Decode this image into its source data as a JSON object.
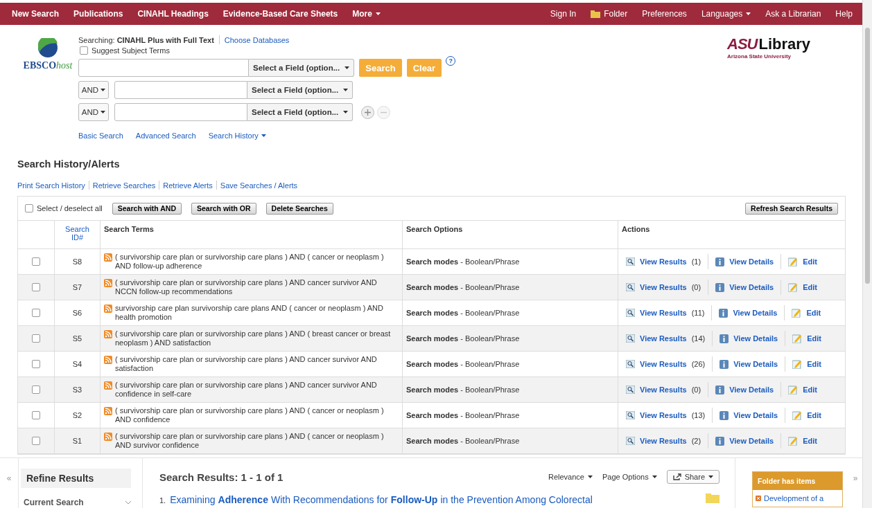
{
  "nav": {
    "left": [
      {
        "label": "New Search",
        "kind": "link"
      },
      {
        "label": "Publications",
        "kind": "link"
      },
      {
        "label": "CINAHL Headings",
        "kind": "link"
      },
      {
        "label": "Evidence-Based Care Sheets",
        "kind": "link"
      },
      {
        "label": "More",
        "kind": "menu"
      }
    ],
    "right": [
      {
        "label": "Sign In",
        "kind": "link"
      },
      {
        "label": "Folder",
        "kind": "folder"
      },
      {
        "label": "Preferences",
        "kind": "link"
      },
      {
        "label": "Languages",
        "kind": "menu"
      },
      {
        "label": "Ask a Librarian",
        "kind": "link"
      },
      {
        "label": "Help",
        "kind": "link"
      }
    ]
  },
  "logo": {
    "text": "EBSCO",
    "suffix": "host"
  },
  "library_logo": {
    "mark": "ASU",
    "name": "Library",
    "subtitle": "Arizona State University"
  },
  "search": {
    "searching_label": "Searching:",
    "database": "CINAHL Plus with Full Text",
    "choose_link": "Choose Databases",
    "suggest": {
      "label": "Suggest Subject Terms",
      "checked": false
    },
    "rows": [
      {
        "field": "Select a Field (option..."
      },
      {
        "operator": "AND",
        "field": "Select a Field (option..."
      },
      {
        "operator": "AND",
        "field": "Select a Field (option..."
      }
    ],
    "search_button": "Search",
    "clear_button": "Clear",
    "help": "?",
    "links": [
      {
        "label": "Basic Search",
        "kind": "link"
      },
      {
        "label": "Advanced Search",
        "kind": "link"
      },
      {
        "label": "Search History",
        "kind": "menu"
      }
    ]
  },
  "history": {
    "title": "Search History/Alerts",
    "links": [
      "Print Search History",
      "Retrieve Searches",
      "Retrieve Alerts",
      "Save Searches / Alerts"
    ],
    "select_all": {
      "label": "Select / deselect all",
      "checked": false
    },
    "buttons": [
      "Search with AND",
      "Search with OR",
      "Delete Searches"
    ],
    "refresh_button": "Refresh Search Results",
    "columns": [
      "Search ID#",
      "Search Terms",
      "Search Options",
      "Actions"
    ],
    "rows": [
      {
        "id": "S8",
        "selected": false,
        "terms": "( survivorship care plan or survivorship care plans ) AND ( cancer or neoplasm ) AND follow-up adherence",
        "options": "**Search modes** - Boolean/Phrase",
        "view_results": "View Results",
        "count": "(1)",
        "view_details": "View Details",
        "edit": "Edit"
      },
      {
        "id": "S7",
        "selected": false,
        "terms": "( survivorship care plan or survivorship care plans ) AND cancer survivor AND NCCN follow-up recommendations",
        "options": "**Search modes** - Boolean/Phrase",
        "view_results": "View Results",
        "count": "(0)",
        "view_details": "View Details",
        "edit": "Edit"
      },
      {
        "id": "S6",
        "selected": false,
        "terms": "survivorship care plan survivorship care plans AND ( cancer or neoplasm ) AND health promotion",
        "options": "**Search modes** - Boolean/Phrase",
        "view_results": "View Results",
        "count": "(11)",
        "view_details": "View Details",
        "edit": "Edit"
      },
      {
        "id": "S5",
        "selected": false,
        "terms": "( survivorship care plan or survivorship care plans ) AND ( breast cancer or breast neoplasm ) AND satisfaction",
        "options": "**Search modes** - Boolean/Phrase",
        "view_results": "View Results",
        "count": "(14)",
        "view_details": "View Details",
        "edit": "Edit"
      },
      {
        "id": "S4",
        "selected": false,
        "terms": "( survivorship care plan or survivorship care plans ) AND cancer survivor AND satisfaction",
        "options": "**Search modes** - Boolean/Phrase",
        "view_results": "View Results",
        "count": "(26)",
        "view_details": "View Details",
        "edit": "Edit"
      },
      {
        "id": "S3",
        "selected": false,
        "terms": "( survivorship care plan or survivorship care plans ) AND cancer survivor AND confidence in self-care",
        "options": "**Search modes** - Boolean/Phrase",
        "view_results": "View Results",
        "count": "(0)",
        "view_details": "View Details",
        "edit": "Edit"
      },
      {
        "id": "S2",
        "selected": false,
        "terms": "( survivorship care plan or survivorship care plans ) AND ( cancer or neoplasm ) AND confidence",
        "options": "**Search modes** - Boolean/Phrase",
        "view_results": "View Results",
        "count": "(13)",
        "view_details": "View Details",
        "edit": "Edit"
      },
      {
        "id": "S1",
        "selected": false,
        "terms": "( survivorship care plan or survivorship care plans ) AND ( cancer or neoplasm ) AND survivor confidence",
        "options": "**Search modes** - Boolean/Phrase",
        "view_results": "View Results",
        "count": "(2)",
        "view_details": "View Details",
        "edit": "Edit"
      }
    ]
  },
  "results": {
    "collapse_left": "«",
    "refine_title": "Refine Results",
    "current_search": "Current Search",
    "summary": "Search Results: 1 - 1 of 1",
    "controls": [
      {
        "label": "Relevance",
        "kind": "menu"
      },
      {
        "label": "Page Options",
        "kind": "menu"
      },
      {
        "label": "Share",
        "kind": "share"
      }
    ],
    "items": [
      {
        "number": "1.",
        "title": "Examining **Adherence** With Recommendations for **Follow-Up** in the Prevention Among Colorectal"
      }
    ],
    "folder": {
      "title": "Folder has items",
      "items": [
        "Development of a"
      ]
    },
    "collapse_right": "»"
  }
}
